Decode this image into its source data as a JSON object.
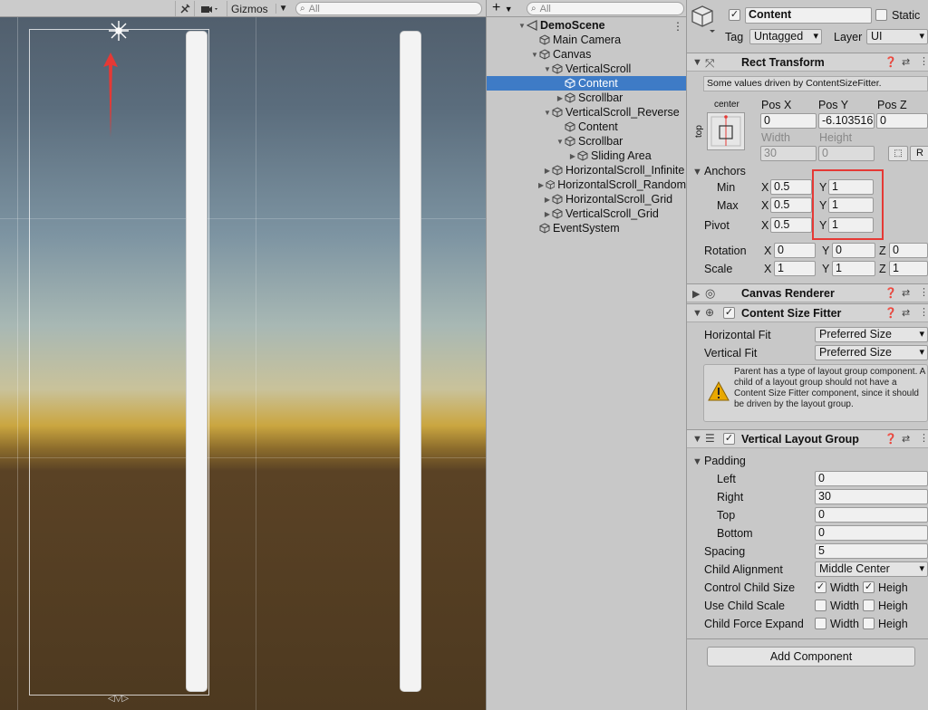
{
  "scene": {
    "toolbar": {
      "gizmos_label": "Gizmos",
      "search_placeholder": "All"
    }
  },
  "hierarchy": {
    "search_placeholder": "All",
    "add_label": "+",
    "items": [
      {
        "label": "DemoScene",
        "depth": 0,
        "fold": "open",
        "icon": "unity-scene-icon",
        "bold": true
      },
      {
        "label": "Main Camera",
        "depth": 1,
        "fold": "none",
        "icon": "cube-icon"
      },
      {
        "label": "Canvas",
        "depth": 1,
        "fold": "open",
        "icon": "cube-icon"
      },
      {
        "label": "VerticalScroll",
        "depth": 2,
        "fold": "open",
        "icon": "cube-icon"
      },
      {
        "label": "Content",
        "depth": 3,
        "fold": "none",
        "icon": "cube-icon",
        "selected": true
      },
      {
        "label": "Scrollbar",
        "depth": 3,
        "fold": "closed",
        "icon": "cube-icon"
      },
      {
        "label": "VerticalScroll_Reverse",
        "depth": 2,
        "fold": "open",
        "icon": "cube-icon"
      },
      {
        "label": "Content",
        "depth": 3,
        "fold": "none",
        "icon": "cube-icon"
      },
      {
        "label": "Scrollbar",
        "depth": 3,
        "fold": "open",
        "icon": "cube-icon"
      },
      {
        "label": "Sliding Area",
        "depth": 4,
        "fold": "closed",
        "icon": "cube-icon"
      },
      {
        "label": "HorizontalScroll_Infinite",
        "depth": 2,
        "fold": "closed",
        "icon": "cube-icon"
      },
      {
        "label": "HorizontalScroll_Random",
        "depth": 2,
        "fold": "closed",
        "icon": "cube-icon"
      },
      {
        "label": "HorizontalScroll_Grid",
        "depth": 2,
        "fold": "closed",
        "icon": "cube-icon"
      },
      {
        "label": "VerticalScroll_Grid",
        "depth": 2,
        "fold": "closed",
        "icon": "cube-icon"
      },
      {
        "label": "EventSystem",
        "depth": 1,
        "fold": "none",
        "icon": "cube-icon"
      }
    ]
  },
  "inspector": {
    "object_name": "Content",
    "static_label": "Static",
    "tag_label": "Tag",
    "tag_value": "Untagged",
    "layer_label": "Layer",
    "layer_value": "UI",
    "rect_transform": {
      "title": "Rect Transform",
      "driven_note": "Some values driven by ContentSizeFitter.",
      "anchor_h": "center",
      "anchor_v": "top",
      "pos_x_label": "Pos X",
      "pos_y_label": "Pos Y",
      "pos_z_label": "Pos Z",
      "pos_x": "0",
      "pos_y": "-6.103516",
      "pos_z": "0",
      "width_label": "Width",
      "height_label": "Height",
      "width": "30",
      "height": "0",
      "anchors_label": "Anchors",
      "min_label": "Min",
      "max_label": "Max",
      "pivot_label": "Pivot",
      "x_label": "X",
      "y_label": "Y",
      "z_label": "Z",
      "min_x": "0.5",
      "min_y": "1",
      "max_x": "0.5",
      "max_y": "1",
      "pivot_x": "0.5",
      "pivot_y": "1",
      "rotation_label": "Rotation",
      "rot_x": "0",
      "rot_y": "0",
      "rot_z": "0",
      "scale_label": "Scale",
      "scale_x": "1",
      "scale_y": "1",
      "scale_z": "1",
      "raw_btn_label": "R"
    },
    "canvas_renderer": {
      "title": "Canvas Renderer"
    },
    "content_size_fitter": {
      "title": "Content Size Fitter",
      "horizontal_fit_label": "Horizontal Fit",
      "horizontal_fit": "Preferred Size",
      "vertical_fit_label": "Vertical Fit",
      "vertical_fit": "Preferred Size",
      "warning": "Parent has a type of layout group component. A child of a layout group should not have a Content Size Fitter component, since it should be driven by the layout group."
    },
    "vertical_layout_group": {
      "title": "Vertical Layout Group",
      "padding_label": "Padding",
      "left_label": "Left",
      "left": "0",
      "right_label": "Right",
      "right": "30",
      "top_label": "Top",
      "top": "0",
      "bottom_label": "Bottom",
      "bottom": "0",
      "spacing_label": "Spacing",
      "spacing": "5",
      "child_alignment_label": "Child Alignment",
      "child_alignment": "Middle Center",
      "control_child_size_label": "Control Child Size",
      "use_child_scale_label": "Use Child Scale",
      "child_force_expand_label": "Child Force Expand",
      "width_label": "Width",
      "height_label": "Heigh"
    },
    "add_component_label": "Add Component"
  },
  "colors": {
    "selection": "#3e7bc6",
    "highlight_box": "#e53935",
    "arrow": "#e53935"
  }
}
